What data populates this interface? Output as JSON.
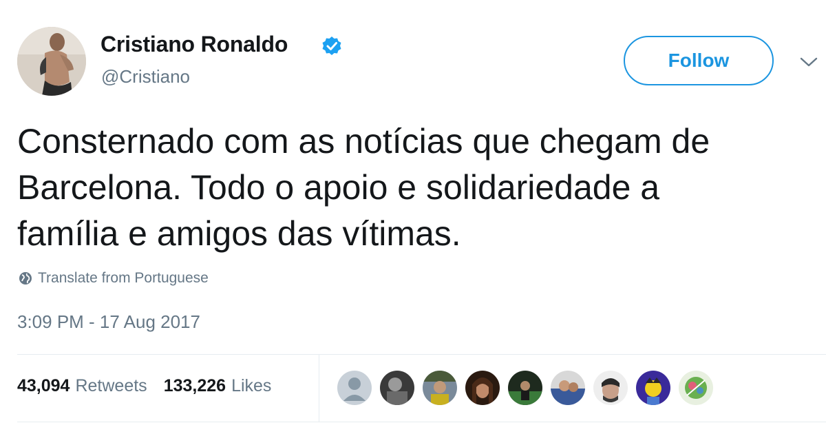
{
  "user": {
    "display_name": "Cristiano Ronaldo",
    "handle": "@Cristiano",
    "verified": true,
    "avatar_icon": "profile-photo"
  },
  "follow_button": {
    "label": "Follow"
  },
  "menu_icon": "chevron-down-icon",
  "tweet": {
    "lines": [
      "Consternado com as notícias que chegam de",
      "Barcelona. Todo o apoio e solidariedade a",
      "família e amigos das vítimas."
    ],
    "translate_label": "Translate from Portuguese",
    "timestamp": "3:09 PM - 17 Aug 2017"
  },
  "stats": {
    "retweets_count": "43,094",
    "retweets_label": "Retweets",
    "likes_count": "133,226",
    "likes_label": "Likes"
  },
  "likers": [
    {
      "name": "liker-avatar-default",
      "color": "#c8d0d8"
    },
    {
      "name": "liker-avatar-2",
      "color": "#5a5a5a"
    },
    {
      "name": "liker-avatar-3",
      "color": "#6b7a5a"
    },
    {
      "name": "liker-avatar-4",
      "color": "#4a3020"
    },
    {
      "name": "liker-avatar-5",
      "color": "#2e4a2e"
    },
    {
      "name": "liker-avatar-6",
      "color": "#3a5a8a"
    },
    {
      "name": "liker-avatar-7",
      "color": "#3a3a3a"
    },
    {
      "name": "liker-avatar-8",
      "color": "#4a3aa0"
    },
    {
      "name": "liker-avatar-9",
      "color": "#6aa050"
    }
  ],
  "colors": {
    "accent": "#1b95e0",
    "verified": "#1da1f2",
    "muted_text": "#657786",
    "primary_text": "#14171a"
  }
}
